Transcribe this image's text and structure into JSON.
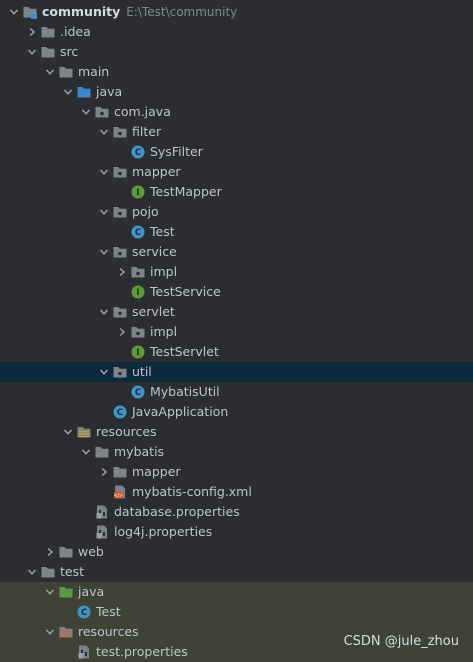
{
  "tree": [
    {
      "label": "community",
      "sub": "E:\\Test\\community",
      "icon": "module-folder-icon",
      "state": "expanded",
      "bold": true
    },
    {
      "label": ".idea",
      "icon": "folder-icon",
      "state": "collapsed"
    },
    {
      "label": "src",
      "icon": "folder-icon",
      "state": "expanded"
    },
    {
      "label": "main",
      "icon": "folder-icon",
      "state": "expanded"
    },
    {
      "label": "java",
      "icon": "source-folder-icon",
      "state": "expanded"
    },
    {
      "label": "com.java",
      "icon": "package-icon",
      "state": "expanded"
    },
    {
      "label": "filter",
      "icon": "package-icon",
      "state": "expanded"
    },
    {
      "label": "SysFilter",
      "icon": "class-icon",
      "state": "leaf"
    },
    {
      "label": "mapper",
      "icon": "package-icon",
      "state": "expanded"
    },
    {
      "label": "TestMapper",
      "icon": "interface-icon",
      "state": "leaf"
    },
    {
      "label": "pojo",
      "icon": "package-icon",
      "state": "expanded"
    },
    {
      "label": "Test",
      "icon": "class-icon",
      "state": "leaf"
    },
    {
      "label": "service",
      "icon": "package-icon",
      "state": "expanded"
    },
    {
      "label": "impl",
      "icon": "package-icon",
      "state": "collapsed"
    },
    {
      "label": "TestService",
      "icon": "interface-icon",
      "state": "leaf"
    },
    {
      "label": "servlet",
      "icon": "package-icon",
      "state": "expanded"
    },
    {
      "label": "impl",
      "icon": "package-icon",
      "state": "collapsed"
    },
    {
      "label": "TestServlet",
      "icon": "interface-icon",
      "state": "leaf"
    },
    {
      "label": "util",
      "icon": "package-icon",
      "state": "expanded",
      "selected": true
    },
    {
      "label": "MybatisUtil",
      "icon": "class-icon",
      "state": "leaf"
    },
    {
      "label": "JavaApplication",
      "icon": "class-icon",
      "state": "leaf"
    },
    {
      "label": "resources",
      "icon": "resources-folder-icon",
      "state": "expanded"
    },
    {
      "label": "mybatis",
      "icon": "folder-icon",
      "state": "expanded"
    },
    {
      "label": "mapper",
      "icon": "folder-icon",
      "state": "collapsed"
    },
    {
      "label": "mybatis-config.xml",
      "icon": "xml-file-icon",
      "state": "leaf"
    },
    {
      "label": "database.properties",
      "icon": "properties-file-icon",
      "state": "leaf"
    },
    {
      "label": "log4j.properties",
      "icon": "properties-file-icon",
      "state": "leaf"
    },
    {
      "label": "web",
      "icon": "folder-icon",
      "state": "collapsed"
    },
    {
      "label": "test",
      "icon": "folder-icon",
      "state": "expanded"
    },
    {
      "label": "java",
      "icon": "test-source-folder-icon",
      "state": "expanded",
      "test": true
    },
    {
      "label": "Test",
      "icon": "class-icon",
      "state": "leaf",
      "test": true
    },
    {
      "label": "resources",
      "icon": "test-resources-folder-icon",
      "state": "expanded",
      "test": true
    },
    {
      "label": "test.properties",
      "icon": "properties-file-icon",
      "state": "leaf",
      "test": true
    }
  ],
  "watermark": "CSDN @jule_zhou"
}
